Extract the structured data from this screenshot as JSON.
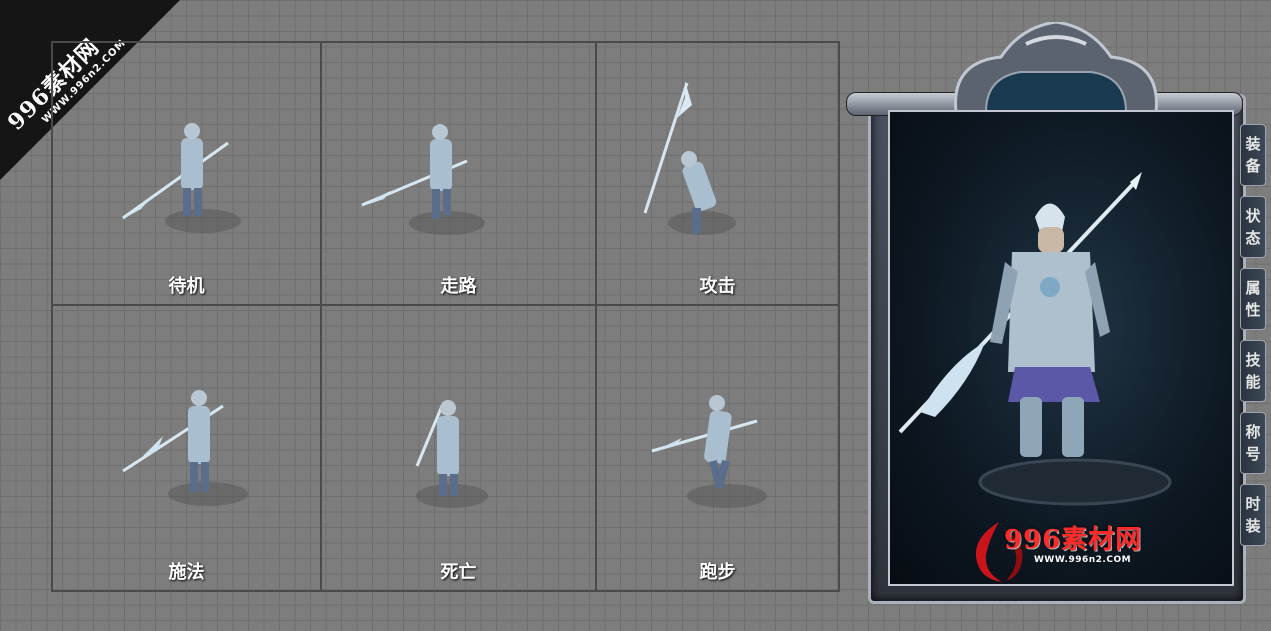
{
  "watermark": {
    "title": "996素材网",
    "url": "WWW.996n2.COM"
  },
  "actions": [
    {
      "label": "待机"
    },
    {
      "label": "走路"
    },
    {
      "label": "攻击"
    },
    {
      "label": "施法"
    },
    {
      "label": "死亡"
    },
    {
      "label": "跑步"
    }
  ],
  "panel": {
    "tabs": [
      "装备",
      "状态",
      "属性",
      "技能",
      "称号",
      "时装"
    ],
    "logo": {
      "title": "996素材网",
      "url": "WWW.996n2.COM"
    }
  }
}
